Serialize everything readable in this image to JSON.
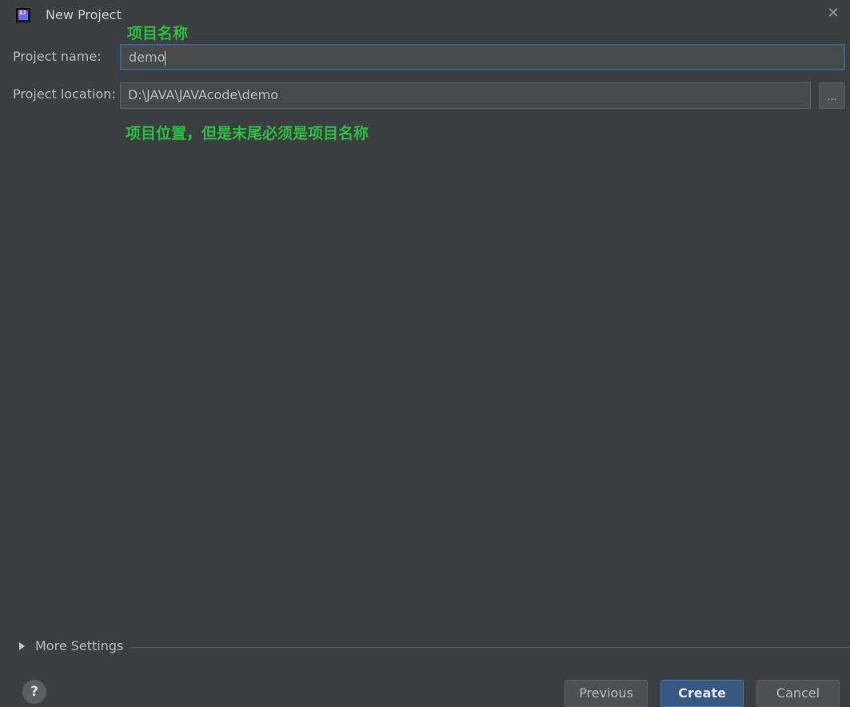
{
  "window": {
    "title": "New Project",
    "close_glyph": "✕"
  },
  "annotations": {
    "project_name_note": "项目名称",
    "location_note": "项目位置，但是末尾必须是项目名称"
  },
  "form": {
    "name_label": "Project name:",
    "name_value": "demo",
    "location_label": "Project location:",
    "location_value": "D:\\JAVA\\JAVAcode\\demo",
    "browse_label": "..."
  },
  "more_settings": {
    "label": "More Settings"
  },
  "footer": {
    "help_label": "?",
    "previous_label": "Previous",
    "create_label": "Create",
    "cancel_label": "Cancel"
  },
  "colors": {
    "background": "#3c3f41",
    "annotation": "#2cbf3f",
    "primary_button": "#365880",
    "focus_border": "#3d6185"
  }
}
